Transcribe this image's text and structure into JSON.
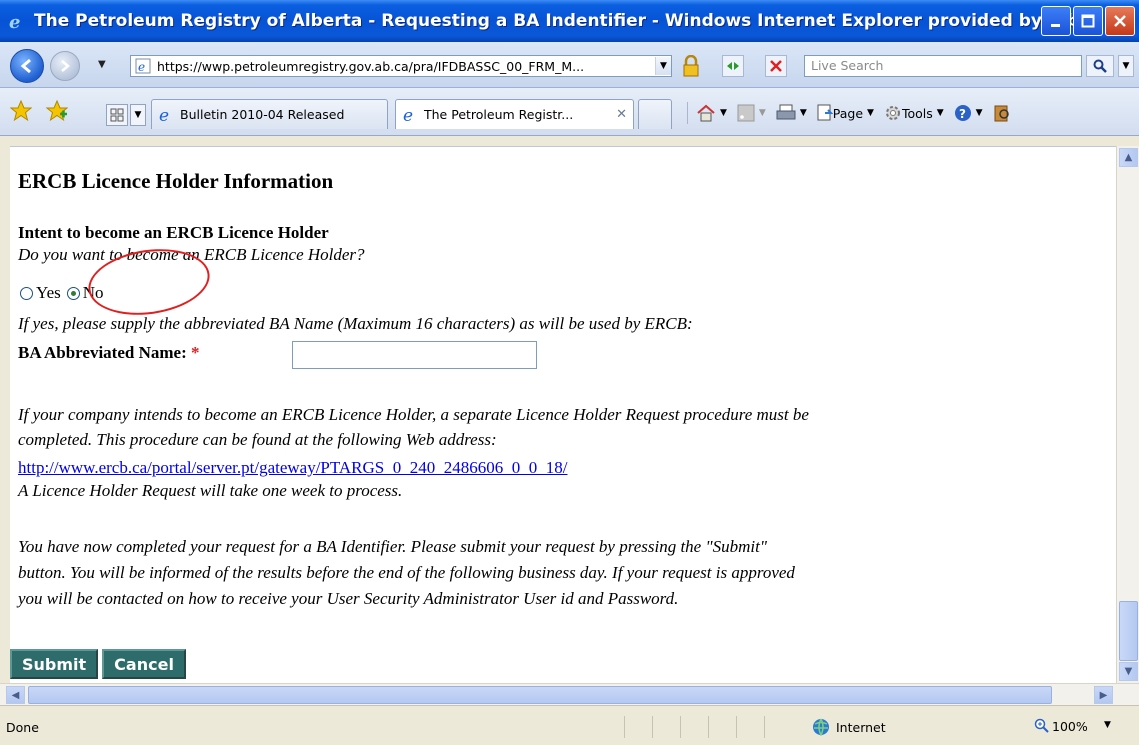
{
  "window": {
    "title": "The Petroleum Registry of Alberta - Requesting a BA Indentifier - Windows Internet Explorer provided by Albe..."
  },
  "address_bar": {
    "url": "https://wwp.petroleumregistry.gov.ab.ca/pra/IFDBASSC_00_FRM_M...",
    "search_placeholder": "Live Search"
  },
  "tabs": [
    {
      "label": "Bulletin 2010-04 Released"
    },
    {
      "label": "The Petroleum Registr..."
    },
    {
      "label": ""
    }
  ],
  "command_bar": {
    "page_label": "Page",
    "tools_label": "Tools"
  },
  "form": {
    "page_title": "ERCB Licence Holder Information",
    "section_title": "Intent to become an ERCB Licence Holder",
    "question": "Do you want to become an ERCB Licence Holder?",
    "radio_yes": "Yes",
    "radio_no": "No",
    "selected": "No",
    "abbrev_instruction": "If yes, please supply the abbreviated BA Name (Maximum 16 characters) as will be used by ERCB:",
    "ba_label": "BA Abbreviated Name:",
    "required_mark": "*",
    "ba_value": "",
    "info_line1": "If your company intends to become an ERCB Licence Holder, a separate Licence Holder Request procedure must be",
    "info_line2": "completed.  This procedure can be found at the following Web address:",
    "info_link": "http://www.ercb.ca/portal/server.pt/gateway/PTARGS_0_240_2486606_0_0_18/",
    "info_line3": "A Licence Holder Request will take one week to process.",
    "complete_line1": "You have now completed your request for a BA Identifier. Please submit your request by pressing the \"Submit\"",
    "complete_line2": "button. You will be informed of the results before the end of the following business day. If your request is approved",
    "complete_line3": "you will be contacted on how to receive your User Security Administrator User id and Password.",
    "submit_label": "Submit",
    "cancel_label": "Cancel"
  },
  "status_bar": {
    "status": "Done",
    "zone": "Internet",
    "zoom": "100%"
  },
  "colors": {
    "button_bg": "#2d6c6a",
    "link": "#0000ee",
    "annotation": "#e02020"
  }
}
